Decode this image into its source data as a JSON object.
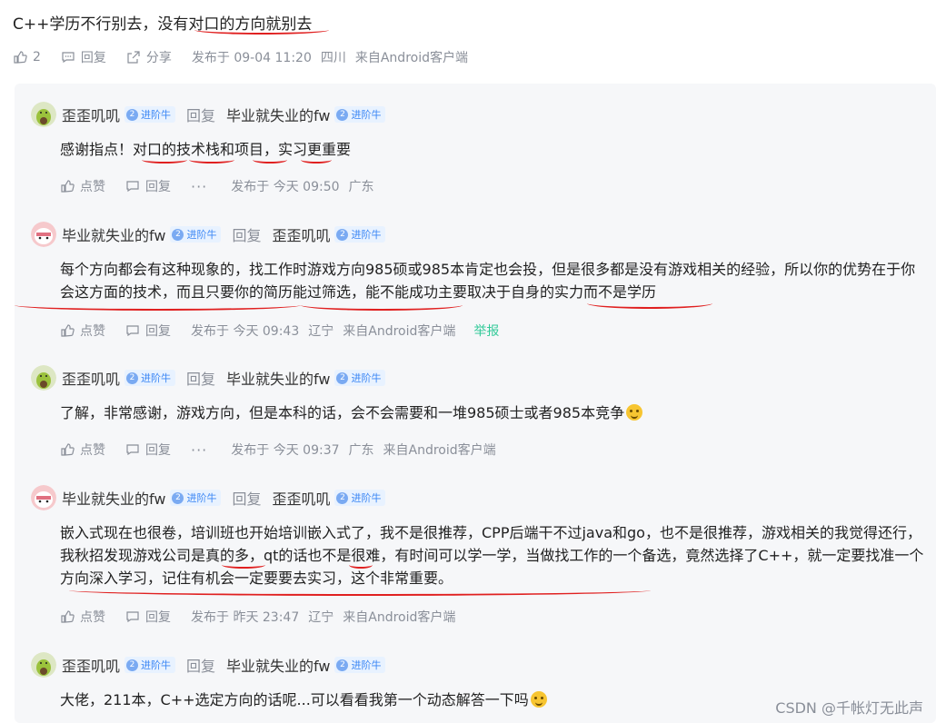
{
  "main_comment": {
    "text": "C++学历不行别去，没有对口的方向就别去",
    "likes": "2",
    "reply_label": "回复",
    "share_label": "分享",
    "published": "发布于 09-04 11:20",
    "location": "四川",
    "source": "来自Android客户端"
  },
  "replies": [
    {
      "author": "歪歪叽叽",
      "author_level": "2",
      "author_badge": "进阶牛",
      "reply_word": "回复",
      "target": "毕业就失业的fw",
      "target_level": "2",
      "target_badge": "进阶牛",
      "text": "感谢指点！对口的技术栈和项目，实习更重要",
      "like_label": "点赞",
      "reply_label": "回复",
      "more": "···",
      "published": "发布于 今天 09:50",
      "location": "广东",
      "source": ""
    },
    {
      "author": "毕业就失业的fw",
      "author_level": "2",
      "author_badge": "进阶牛",
      "reply_word": "回复",
      "target": "歪歪叽叽",
      "target_level": "2",
      "target_badge": "进阶牛",
      "text": "每个方向都会有这种现象的，找工作时游戏方向985硕或985本肯定也会投，但是很多都是没有游戏相关的经验，所以你的优势在于你会这方面的技术，而且只要你的简历能过筛选，能不能成功主要取决于自身的实力而不是学历",
      "like_label": "点赞",
      "reply_label": "回复",
      "more": "",
      "published": "发布于 今天 09:43",
      "location": "辽宁",
      "source": "来自Android客户端",
      "report": "举报"
    },
    {
      "author": "歪歪叽叽",
      "author_level": "2",
      "author_badge": "进阶牛",
      "reply_word": "回复",
      "target": "毕业就失业的fw",
      "target_level": "2",
      "target_badge": "进阶牛",
      "text": "了解，非常感谢，游戏方向，但是本科的话，会不会需要和一堆985硕士或者985本竞争",
      "like_label": "点赞",
      "reply_label": "回复",
      "more": "···",
      "published": "发布于 今天 09:37",
      "location": "广东",
      "source": "来自Android客户端"
    },
    {
      "author": "毕业就失业的fw",
      "author_level": "2",
      "author_badge": "进阶牛",
      "reply_word": "回复",
      "target": "歪歪叽叽",
      "target_level": "2",
      "target_badge": "进阶牛",
      "text": "嵌入式现在也很卷，培训班也开始培训嵌入式了，我不是很推荐，CPP后端干不过java和go，也不是很推荐，游戏相关的我觉得还行，我秋招发现游戏公司是真的多，qt的话也不是很难，有时间可以学一学，当做找工作的一个备选，竟然选择了C++，就一定要找准一个方向深入学习，记住有机会一定要要去实习，这个非常重要。",
      "like_label": "点赞",
      "reply_label": "回复",
      "more": "",
      "published": "发布于 昨天 23:47",
      "location": "辽宁",
      "source": "来自Android客户端"
    },
    {
      "author": "歪歪叽叽",
      "author_level": "2",
      "author_badge": "进阶牛",
      "reply_word": "回复",
      "target": "毕业就失业的fw",
      "target_level": "2",
      "target_badge": "进阶牛",
      "text": "大佬，211本，C++选定方向的话呢...可以看看我第一个动态解答一下吗",
      "like_label": "",
      "reply_label": "",
      "more": "",
      "published": "",
      "location": "",
      "source": ""
    }
  ],
  "watermark": "CSDN @千帐灯无此声",
  "colors": {
    "accent_green": "#32ca99",
    "badge_blue": "#3a86f5",
    "annotation_red": "#e02020"
  }
}
